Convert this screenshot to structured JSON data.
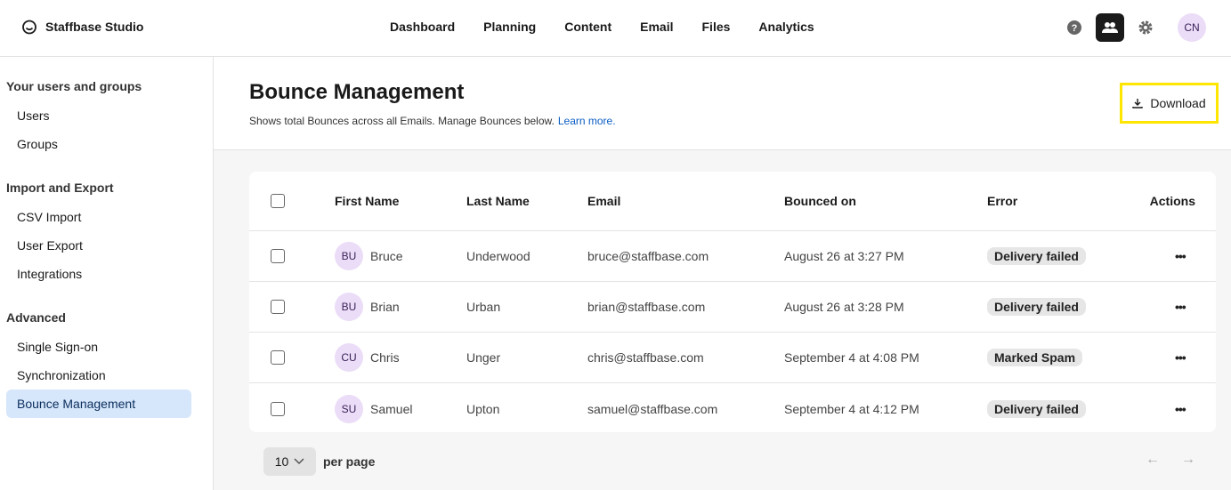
{
  "app": {
    "name": "Staffbase Studio"
  },
  "nav": [
    "Dashboard",
    "Planning",
    "Content",
    "Email",
    "Files",
    "Analytics"
  ],
  "user": {
    "initials": "CN"
  },
  "sidebar": {
    "sections": [
      {
        "title": "Your users and groups",
        "items": [
          "Users",
          "Groups"
        ]
      },
      {
        "title": "Import and Export",
        "items": [
          "CSV Import",
          "User Export",
          "Integrations"
        ]
      },
      {
        "title": "Advanced",
        "items": [
          "Single Sign-on",
          "Synchronization",
          "Bounce Management"
        ]
      }
    ],
    "active": "Bounce Management"
  },
  "page": {
    "title": "Bounce Management",
    "subtitle": "Shows total Bounces across all Emails. Manage Bounces below.",
    "learn_more": "Learn more.",
    "download": "Download"
  },
  "table": {
    "columns": [
      "First Name",
      "Last Name",
      "Email",
      "Bounced on",
      "Error",
      "Actions"
    ],
    "rows": [
      {
        "initials": "BU",
        "first": "Bruce",
        "last": "Underwood",
        "email": "bruce@staffbase.com",
        "bounced": "August 26 at 3:27 PM",
        "error": "Delivery failed"
      },
      {
        "initials": "BU",
        "first": "Brian",
        "last": "Urban",
        "email": "brian@staffbase.com",
        "bounced": "August 26 at 3:28 PM",
        "error": "Delivery failed"
      },
      {
        "initials": "CU",
        "first": "Chris",
        "last": "Unger",
        "email": "chris@staffbase.com",
        "bounced": "September 4 at 4:08 PM",
        "error": "Marked Spam"
      },
      {
        "initials": "SU",
        "first": "Samuel",
        "last": "Upton",
        "email": "samuel@staffbase.com",
        "bounced": "September 4 at 4:12 PM",
        "error": "Delivery failed"
      }
    ]
  },
  "pagination": {
    "per_page_value": "10",
    "per_page_label": "per page"
  }
}
